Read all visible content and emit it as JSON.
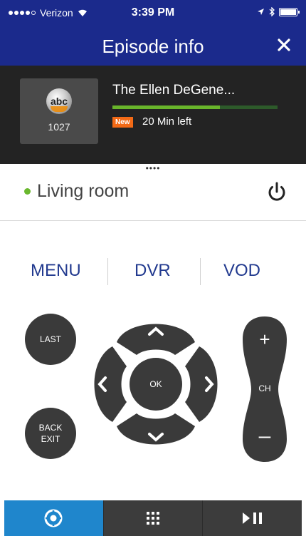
{
  "status_bar": {
    "carrier": "Verizon",
    "time": "3:39 PM"
  },
  "header": {
    "title": "Episode info",
    "close_icon": "close-icon"
  },
  "now_playing": {
    "network_logo_text": "abc",
    "channel_number": "1027",
    "title": "The Ellen DeGene...",
    "badge": "New",
    "time_left": "20 Min left",
    "progress_fraction": 0.65,
    "progress_color": "#69b52b"
  },
  "drag_handle": "••••",
  "room": {
    "name": "Living room",
    "status_color": "#6ab82e",
    "power_icon": "power-icon"
  },
  "menu": {
    "items": [
      {
        "label": "MENU"
      },
      {
        "label": "DVR"
      },
      {
        "label": "VOD"
      }
    ]
  },
  "remote": {
    "last_label": "LAST",
    "back_label_line1": "BACK",
    "back_label_line2": "EXIT",
    "ok_label": "OK",
    "ch_label": "CH",
    "ch_plus": "+",
    "ch_minus": "–",
    "dpad_icons": [
      "chevron-up-icon",
      "chevron-left-icon",
      "chevron-right-icon",
      "chevron-down-icon"
    ]
  },
  "tabs": [
    {
      "icon": "remote-control-icon",
      "active": true
    },
    {
      "icon": "keypad-icon",
      "active": false
    },
    {
      "icon": "play-pause-icon",
      "active": false
    }
  ],
  "colors": {
    "header_blue": "#1b2a8c",
    "menu_blue": "#223a8f",
    "active_tab": "#1f86cc",
    "new_badge": "#f36a16"
  }
}
